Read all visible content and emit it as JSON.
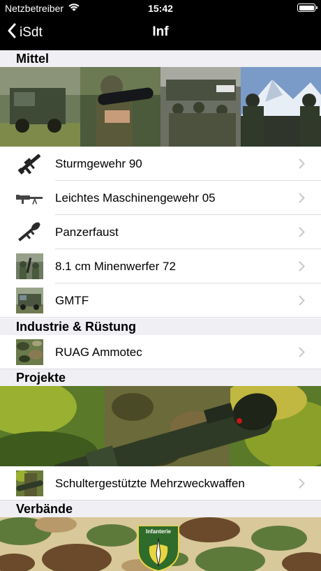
{
  "status_bar": {
    "carrier": "Netzbetreiber",
    "time": "15:42"
  },
  "nav": {
    "back_label": "iSdt",
    "title": "Inf"
  },
  "sections": {
    "mittel": {
      "title": "Mittel",
      "items": [
        {
          "label": "Sturmgewehr 90",
          "icon": "assault-rifle-icon"
        },
        {
          "label": "Leichtes Maschinengewehr 05",
          "icon": "machine-gun-icon"
        },
        {
          "label": "Panzerfaust",
          "icon": "rocket-launcher-icon"
        },
        {
          "label": "8.1 cm Minenwerfer 72",
          "icon": "mortar-photo"
        },
        {
          "label": "GMTF",
          "icon": "truck-photo"
        }
      ]
    },
    "industrie": {
      "title": "Industrie & Rüstung",
      "items": [
        {
          "label": "RUAG Ammotec",
          "icon": "camouflage-photo"
        }
      ]
    },
    "projekte": {
      "title": "Projekte",
      "items": [
        {
          "label": "Schultergestützte Mehrzweckwaffen",
          "icon": "soldier-photo"
        }
      ]
    },
    "verbaende": {
      "title": "Verbände",
      "badge_text": "Infanterie"
    }
  },
  "colors": {
    "header_bg": "#efeff4",
    "separator": "#dcdcdf",
    "chevron": "#c7c7cc",
    "camo_light": "#d8c89a",
    "camo_green": "#5e7a3a",
    "camo_brown": "#6b4a2b",
    "badge_green": "#2f6b2a"
  }
}
